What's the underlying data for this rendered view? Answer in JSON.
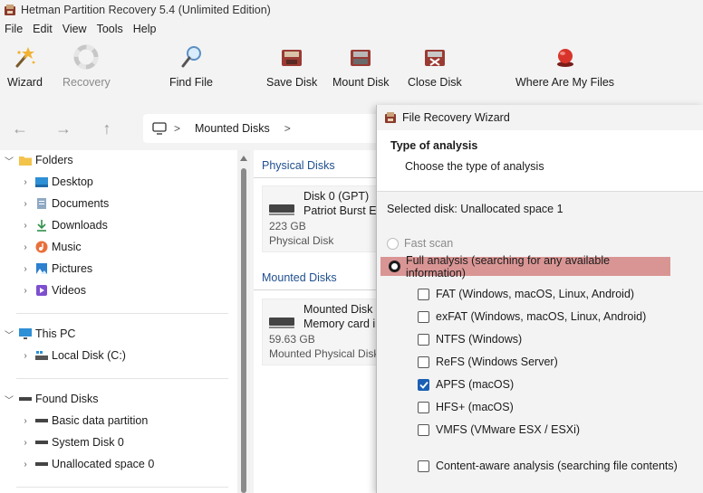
{
  "app": {
    "title": "Hetman Partition Recovery 5.4 (Unlimited Edition)"
  },
  "menu": [
    "File",
    "Edit",
    "View",
    "Tools",
    "Help"
  ],
  "toolbar": {
    "wizard": "Wizard",
    "recovery": "Recovery",
    "find_file": "Find File",
    "save_disk": "Save Disk",
    "mount_disk": "Mount Disk",
    "close_disk": "Close Disk",
    "where_files": "Where Are My Files"
  },
  "nav": {
    "back": "←",
    "forward": "→",
    "up": "↑",
    "sep": ">",
    "crumb": "Mounted Disks"
  },
  "tree": {
    "folders": "Folders",
    "desktop": "Desktop",
    "documents": "Documents",
    "downloads": "Downloads",
    "music": "Music",
    "pictures": "Pictures",
    "videos": "Videos",
    "this_pc": "This PC",
    "local_disk": "Local Disk (C:)",
    "found_disks": "Found Disks",
    "basic_partition": "Basic data partition",
    "system_disk": "System Disk 0",
    "unallocated": "Unallocated space 0"
  },
  "content": {
    "physical_disks": "Physical Disks",
    "mounted_disks": "Mounted Disks",
    "disk0": {
      "name": "Disk 0 (GPT)",
      "model": "Patriot Burst Eli",
      "size": "223 GB",
      "type": "Physical Disk"
    },
    "mounted": {
      "name": "Mounted Disk (",
      "model": "Memory card in",
      "size": "59.63 GB",
      "type": "Mounted Physical Disk"
    }
  },
  "wizard": {
    "title": "File Recovery Wizard",
    "heading": "Type of analysis",
    "subheading": "Choose the type of analysis",
    "selected_disk": "Selected disk: Unallocated space 1",
    "fast_scan": "Fast scan",
    "full_analysis": "Full analysis (searching for any available information)",
    "options": [
      {
        "label": "FAT (Windows, macOS, Linux, Android)",
        "checked": false
      },
      {
        "label": "exFAT (Windows, macOS, Linux, Android)",
        "checked": false
      },
      {
        "label": "NTFS (Windows)",
        "checked": false
      },
      {
        "label": "ReFS (Windows Server)",
        "checked": false
      },
      {
        "label": "APFS (macOS)",
        "checked": true
      },
      {
        "label": "HFS+ (macOS)",
        "checked": false
      },
      {
        "label": "VMFS (VMware ESX / ESXi)",
        "checked": false
      }
    ],
    "content_aware": "Content-aware analysis (searching file contents)"
  },
  "colors": {
    "highlight": "#d99594",
    "accent": "#1a5fb4",
    "section_head": "#1f4f8f"
  }
}
